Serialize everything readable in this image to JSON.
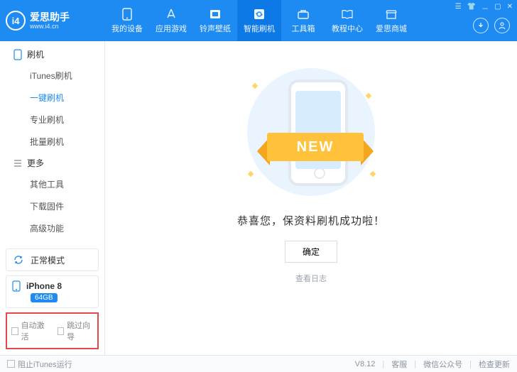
{
  "brand": {
    "title": "爱思助手",
    "url": "www.i4.cn",
    "logo_text": "i4"
  },
  "top_tabs": [
    {
      "label": "我的设备",
      "icon": "phone-icon"
    },
    {
      "label": "应用游戏",
      "icon": "apps-icon"
    },
    {
      "label": "铃声壁纸",
      "icon": "music-icon"
    },
    {
      "label": "智能刷机",
      "icon": "flash-icon"
    },
    {
      "label": "工具箱",
      "icon": "toolbox-icon"
    },
    {
      "label": "教程中心",
      "icon": "book-icon"
    },
    {
      "label": "爱思商城",
      "icon": "store-icon"
    }
  ],
  "active_top_tab_index": 3,
  "sidebar": {
    "groups": [
      {
        "title": "刷机",
        "icon": "phone-outline-icon",
        "items": [
          "iTunes刷机",
          "一键刷机",
          "专业刷机",
          "批量刷机"
        ],
        "active_index": 1
      },
      {
        "title": "更多",
        "icon": "menu-icon",
        "items": [
          "其他工具",
          "下载固件",
          "高级功能"
        ],
        "active_index": -1
      }
    ],
    "mode_card": {
      "label": "正常模式",
      "icon": "refresh-icon"
    },
    "device_card": {
      "name": "iPhone 8",
      "storage": "64GB",
      "icon": "phone-small-icon"
    },
    "red_options": {
      "opt1": "自动激活",
      "opt2": "跳过向导"
    }
  },
  "main": {
    "ribbon_text": "NEW",
    "success_text": "恭喜您，保资料刷机成功啦！",
    "ok_button": "确定",
    "log_link": "查看日志"
  },
  "statusbar": {
    "block_itunes": "阻止iTunes运行",
    "version": "V8.12",
    "links": [
      "客服",
      "微信公众号",
      "检查更新"
    ]
  }
}
